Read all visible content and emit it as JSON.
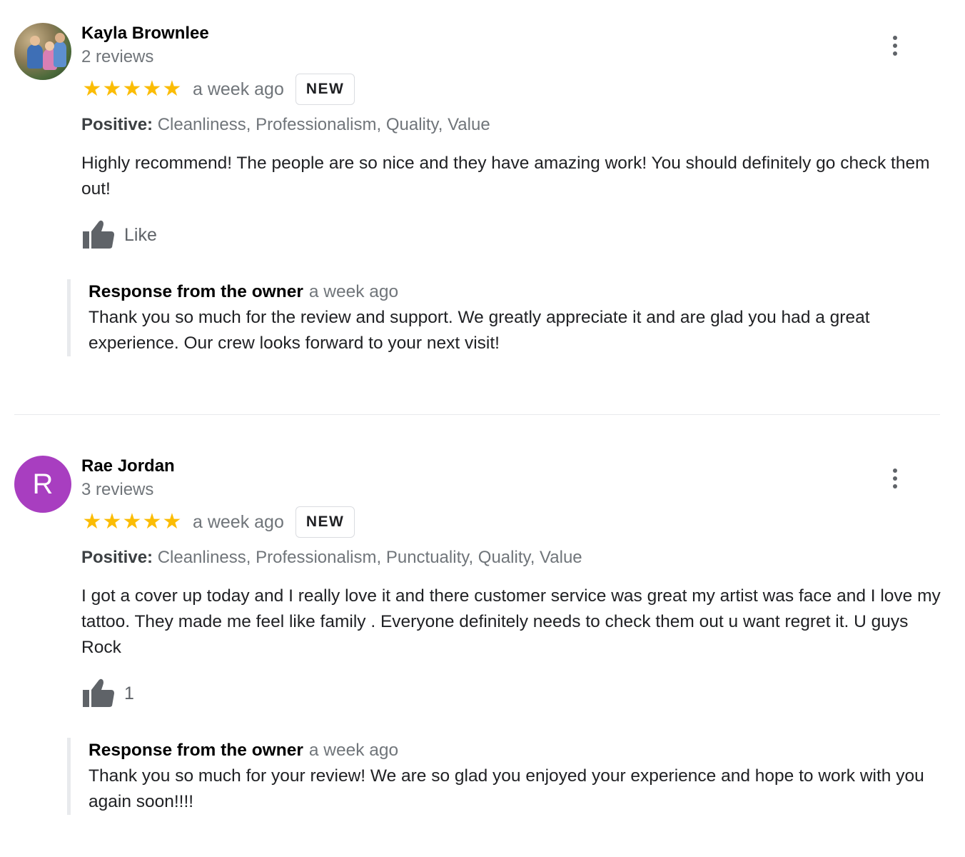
{
  "reviews": [
    {
      "name": "Kayla Brownlee",
      "review_count": "2 reviews",
      "stars": "★★★★★",
      "rating": 5,
      "date": "a week ago",
      "badge": "NEW",
      "positive_label": "Positive:",
      "positive_values": " Cleanliness, Professionalism, Quality, Value",
      "text": "Highly recommend! The people are so nice and they have amazing work! You should definitely go check them out!",
      "like_label": "Like",
      "icons": {
        "more": "more-vert-icon",
        "like": "thumb-up-icon"
      },
      "response": {
        "title": "Response from the owner",
        "date": "a week ago",
        "text": "Thank you so much for the review and support. We greatly appreciate it and are glad you had a great experience. Our crew looks forward to your next visit!"
      }
    },
    {
      "name": "Rae Jordan",
      "avatar_letter": "R",
      "avatar_color": "#a83ec0",
      "review_count": "3 reviews",
      "stars": "★★★★★",
      "rating": 5,
      "date": "a week ago",
      "badge": "NEW",
      "positive_label": "Positive:",
      "positive_values": " Cleanliness, Professionalism, Punctuality, Quality, Value",
      "text": "I got a cover up today and I really love it and there customer service was great my artist was face and I love my tattoo. They made me feel like family . Everyone definitely needs to check them out u want regret it. U guys Rock",
      "like_label": "1",
      "icons": {
        "more": "more-vert-icon",
        "like": "thumb-up-icon"
      },
      "response": {
        "title": "Response from the owner",
        "date": "a week ago",
        "text": "Thank you so much for your review! We are so glad you enjoyed your experience and hope to work with you again soon!!!!"
      }
    }
  ],
  "colors": {
    "star": "#fbbc04",
    "muted": "#70757a",
    "divider": "#e8eaed"
  }
}
